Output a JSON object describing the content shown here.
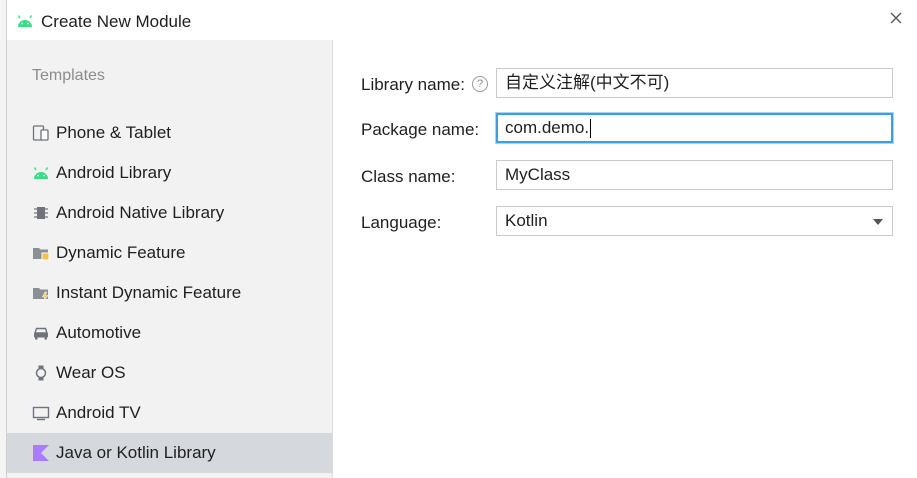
{
  "dialog": {
    "title": "Create New Module",
    "close_icon": "close-icon"
  },
  "sidebar": {
    "heading": "Templates",
    "items": [
      {
        "label": "Phone & Tablet",
        "icon": "phone-tablet-icon",
        "selected": false
      },
      {
        "label": "Android Library",
        "icon": "android-icon",
        "selected": false
      },
      {
        "label": "Android Native Library",
        "icon": "chip-icon",
        "selected": false
      },
      {
        "label": "Dynamic Feature",
        "icon": "folder-feature-icon",
        "selected": false
      },
      {
        "label": "Instant Dynamic Feature",
        "icon": "folder-instant-icon",
        "selected": false
      },
      {
        "label": "Automotive",
        "icon": "car-icon",
        "selected": false
      },
      {
        "label": "Wear OS",
        "icon": "watch-icon",
        "selected": false
      },
      {
        "label": "Android TV",
        "icon": "tv-icon",
        "selected": false
      },
      {
        "label": "Java or Kotlin Library",
        "icon": "kotlin-icon",
        "selected": true
      }
    ]
  },
  "form": {
    "library_name": {
      "label": "Library name:",
      "value": "自定义注解(中文不可)",
      "help_icon": "help-icon"
    },
    "package_name": {
      "label": "Package name:",
      "value": "com.demo."
    },
    "class_name": {
      "label": "Class name:",
      "value": "MyClass"
    },
    "language": {
      "label": "Language:",
      "value": "Kotlin"
    }
  },
  "colors": {
    "android_green": "#3ddc84",
    "kotlin_purple": "#a97bff",
    "focus_blue": "#3b9ee6",
    "selection_bg": "#d5d9de"
  }
}
